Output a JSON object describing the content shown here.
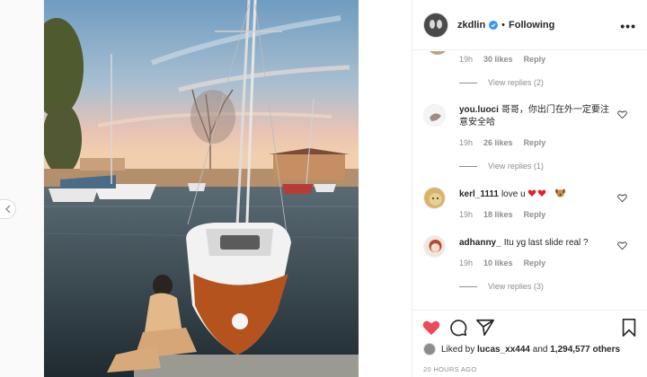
{
  "header": {
    "username": "zkdlin",
    "separator": "•",
    "follow_state": "Following",
    "more_label": "•••"
  },
  "comments": [
    {
      "username": "",
      "text": "",
      "time": "19h",
      "likes": "30 likes",
      "reply": "Reply",
      "view_replies": "View replies (2)"
    },
    {
      "username": "you.luoci",
      "text": "哥哥，你出门在外一定要注意安全哈",
      "time": "19h",
      "likes": "26 likes",
      "reply": "Reply",
      "view_replies": "View replies (1)"
    },
    {
      "username": "kerl_1111",
      "text": "love u",
      "time": "19h",
      "likes": "18 likes",
      "reply": "Reply",
      "view_replies": ""
    },
    {
      "username": "adhanny_",
      "text": "Itu yg last slide real ?",
      "time": "19h",
      "likes": "10 likes",
      "reply": "Reply",
      "view_replies": "View replies (3)"
    }
  ],
  "likes": {
    "prefix": "Liked by",
    "user": "lucas_xx444",
    "conj": "and",
    "count": "1,294,577 others"
  },
  "time_ago": "20 HOURS AGO",
  "colors": {
    "like_red": "#ed4956",
    "verified_blue": "#3897f0",
    "muted": "#8e8e8e"
  },
  "icons": [
    "chevron-left-icon",
    "verified-badge-icon",
    "heart-filled-icon",
    "comment-icon",
    "share-icon",
    "bookmark-icon",
    "heart-outline-icon"
  ]
}
